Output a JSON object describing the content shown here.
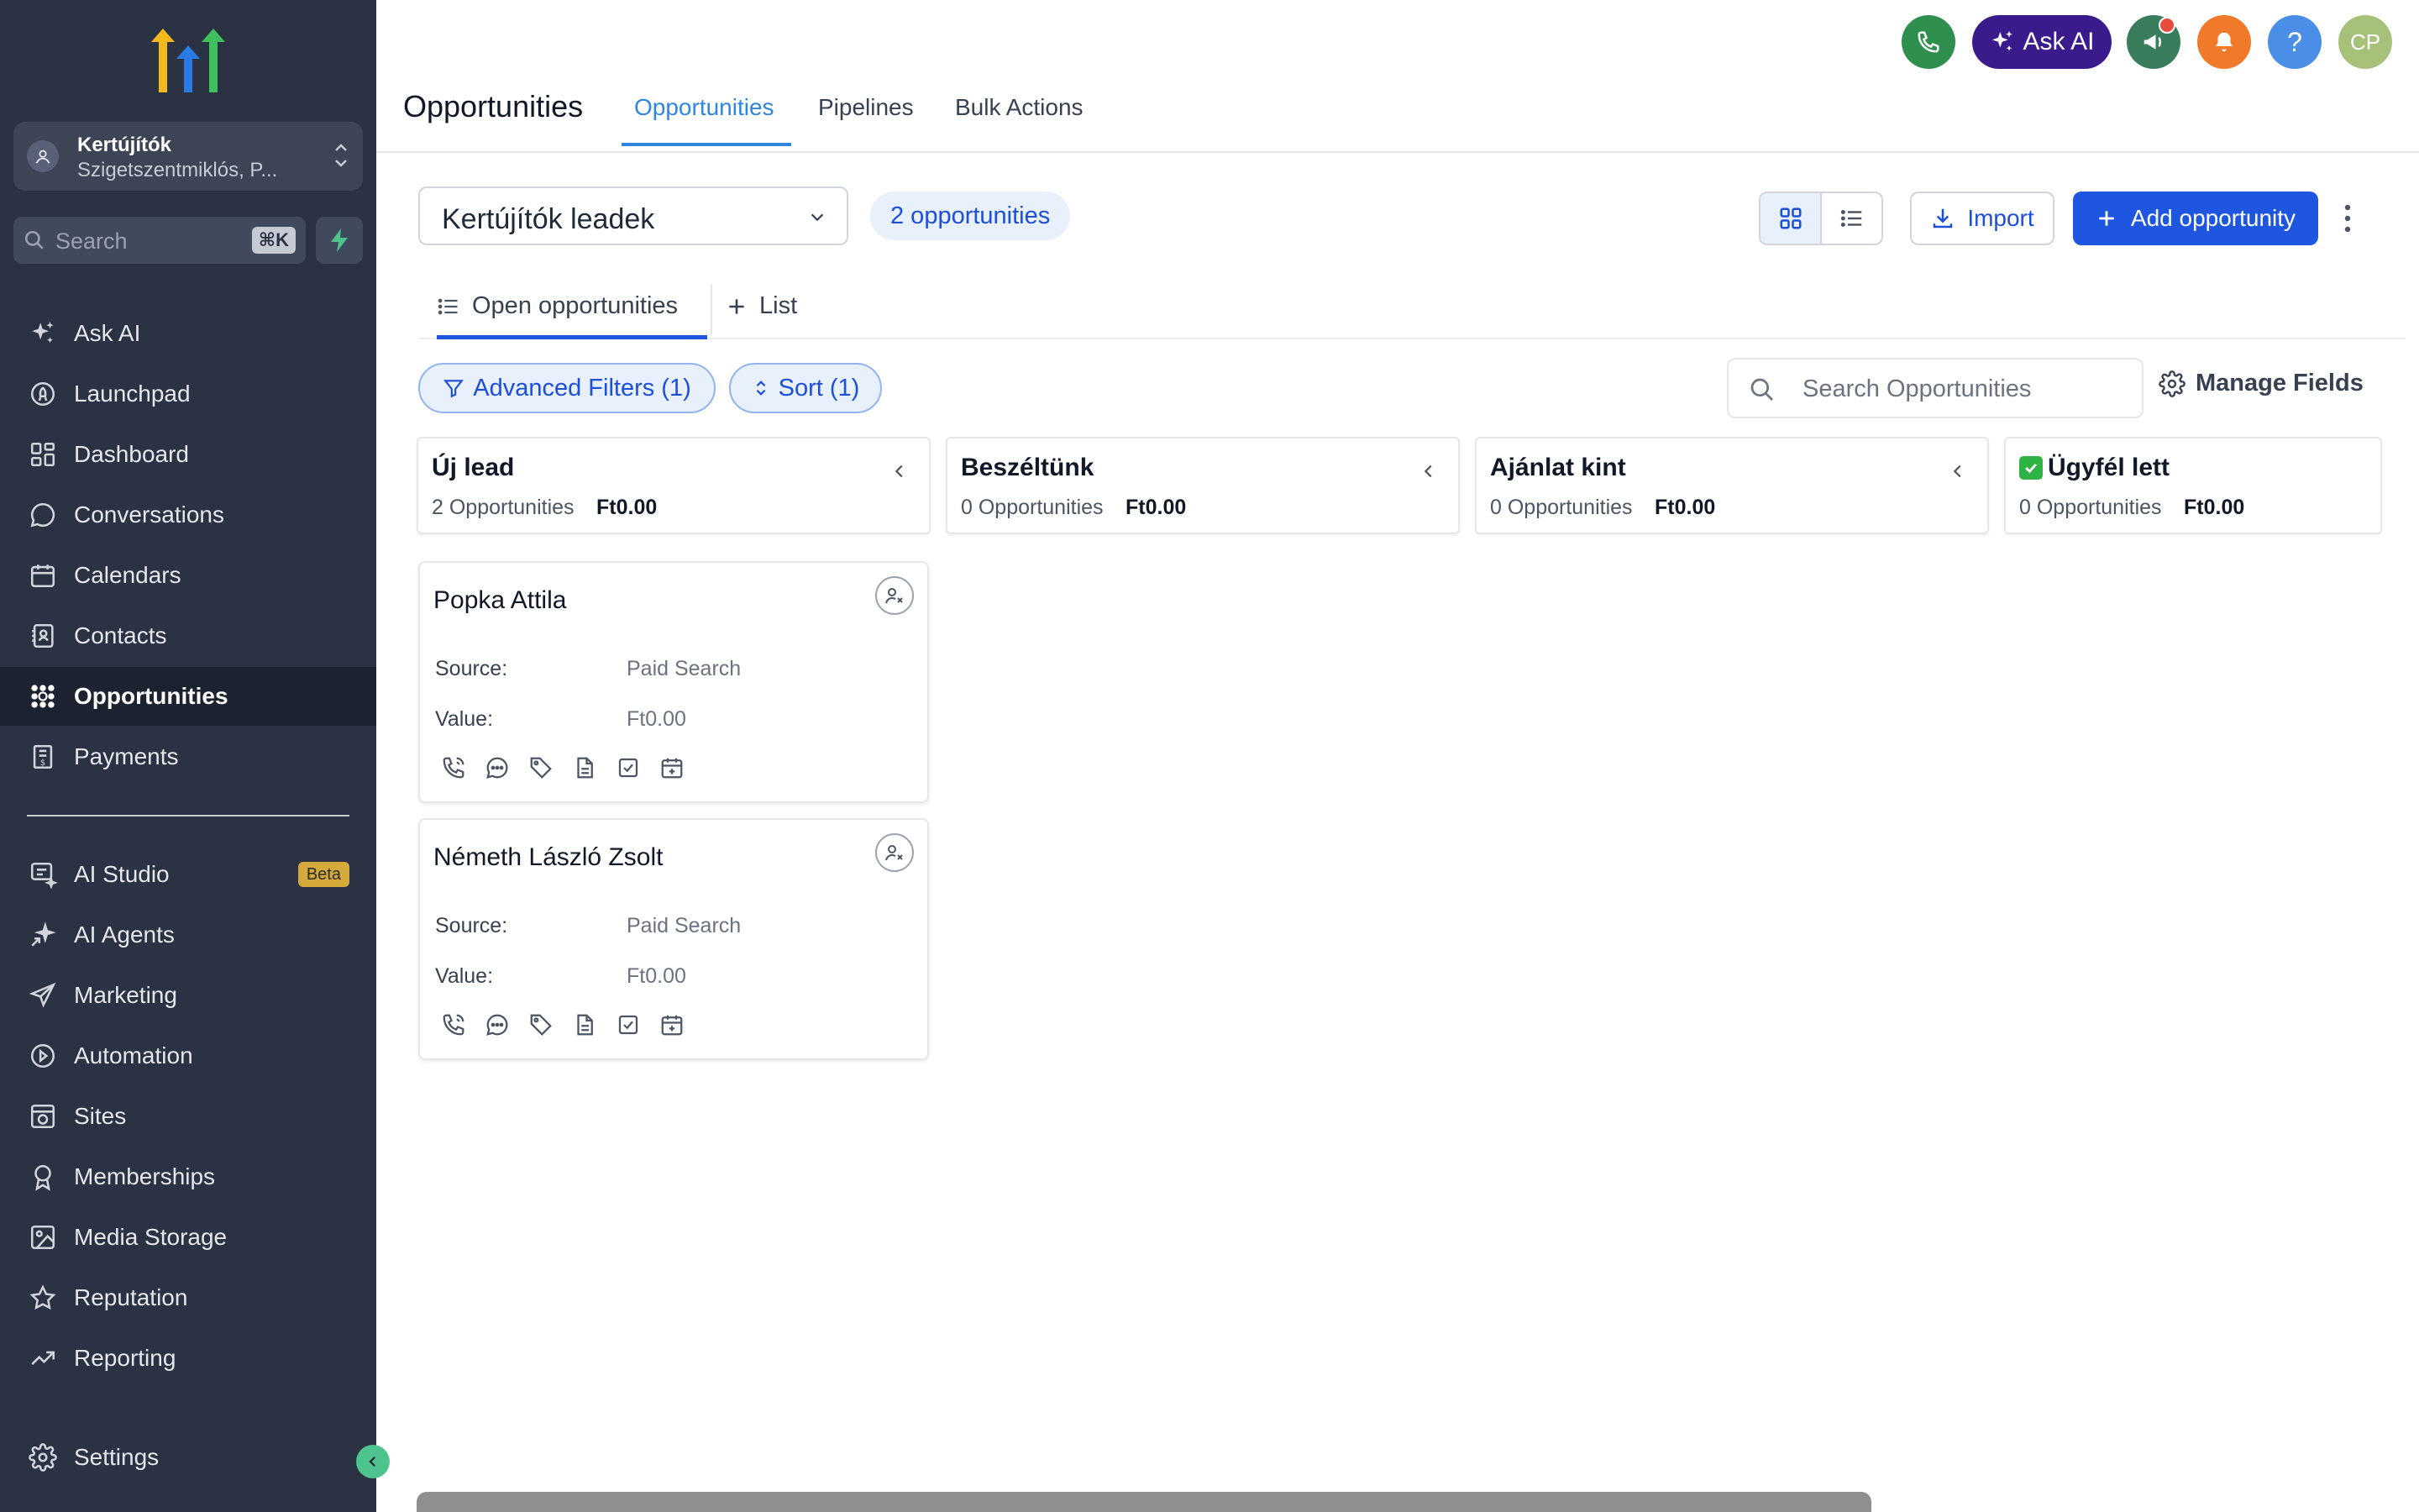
{
  "sidebar": {
    "account": {
      "name": "Kertújítók",
      "location": "Szigetszentmiklós, P..."
    },
    "search": {
      "placeholder": "Search",
      "shortcut": "⌘K"
    },
    "items": [
      {
        "label": "Ask AI",
        "icon": "sparkle-icon"
      },
      {
        "label": "Launchpad",
        "icon": "rocket-icon"
      },
      {
        "label": "Dashboard",
        "icon": "dashboard-icon"
      },
      {
        "label": "Conversations",
        "icon": "chat-icon"
      },
      {
        "label": "Calendars",
        "icon": "calendar-icon"
      },
      {
        "label": "Contacts",
        "icon": "contacts-icon"
      },
      {
        "label": "Opportunities",
        "icon": "opportunities-icon",
        "active": true
      },
      {
        "label": "Payments",
        "icon": "payments-icon"
      }
    ],
    "items2": [
      {
        "label": "AI Studio",
        "icon": "ai-studio-icon",
        "badge": "Beta"
      },
      {
        "label": "AI Agents",
        "icon": "ai-agents-icon"
      },
      {
        "label": "Marketing",
        "icon": "send-icon"
      },
      {
        "label": "Automation",
        "icon": "automation-icon"
      },
      {
        "label": "Sites",
        "icon": "sites-icon"
      },
      {
        "label": "Memberships",
        "icon": "award-icon"
      },
      {
        "label": "Media Storage",
        "icon": "image-icon"
      },
      {
        "label": "Reputation",
        "icon": "star-icon"
      },
      {
        "label": "Reporting",
        "icon": "trend-icon"
      }
    ],
    "settings_label": "Settings"
  },
  "header": {
    "title": "Opportunities",
    "tabs": [
      {
        "label": "Opportunities",
        "active": true
      },
      {
        "label": "Pipelines"
      },
      {
        "label": "Bulk Actions"
      }
    ],
    "ask_ai_label": "Ask AI",
    "avatar_initials": "CP",
    "help_label": "?"
  },
  "toolbar": {
    "pipeline": "Kertújítók leadek",
    "count_label": "2 opportunities",
    "import_label": "Import",
    "add_label": "Add opportunity"
  },
  "subtabs": {
    "open": "Open opportunities",
    "list": "List"
  },
  "filters": {
    "advanced": "Advanced Filters (1)",
    "sort": "Sort (1)",
    "search_placeholder": "Search Opportunities",
    "manage_fields": "Manage Fields"
  },
  "columns": [
    {
      "title": "Új lead",
      "count": "2 Opportunities",
      "amount": "Ft0.00"
    },
    {
      "title": "Beszéltünk",
      "count": "0 Opportunities",
      "amount": "Ft0.00"
    },
    {
      "title": "Ajánlat kint",
      "count": "0 Opportunities",
      "amount": "Ft0.00"
    },
    {
      "title": "Ügyfél lett",
      "count": "0 Opportunities",
      "amount": "Ft0.00"
    }
  ],
  "cards": [
    {
      "name": "Popka Attila",
      "source_label": "Source:",
      "source": "Paid Search",
      "value_label": "Value:",
      "value": "Ft0.00"
    },
    {
      "name": "Németh László Zsolt",
      "source_label": "Source:",
      "source": "Paid Search",
      "value_label": "Value:",
      "value": "Ft0.00"
    }
  ],
  "colors": {
    "sidebar_bg": "#2b3243",
    "accent": "#1f56e0",
    "tab_active": "#2e86de",
    "phone_btn": "#2f8f4e",
    "ask_ai_btn": "#3b1a8c",
    "announce_btn": "#3a7d5c",
    "bell_btn": "#f07a2a",
    "help_btn": "#4a8ee8",
    "avatar_bg": "#a6c27a"
  }
}
